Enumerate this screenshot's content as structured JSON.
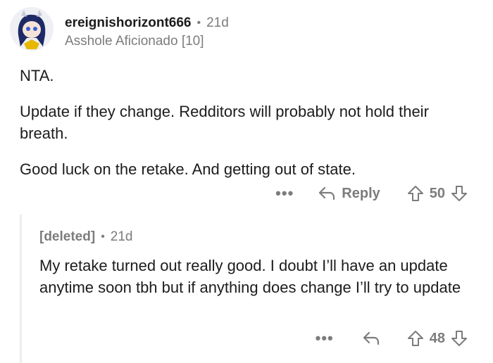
{
  "comment": {
    "username": "ereignishorizont666",
    "separator": "•",
    "age": "21d",
    "flair": "Asshole Aficionado [10]",
    "paragraphs": [
      "NTA.",
      "Update if they change. Redditors will probably not hold their breath.",
      "Good luck on the retake. And getting out of state."
    ],
    "actions": {
      "more_label": "•••",
      "reply_label": "Reply",
      "vote_count": "50"
    }
  },
  "reply": {
    "username": "[deleted]",
    "separator": "•",
    "age": "21d",
    "body": "My retake turned out really good. I doubt I’ll have an update anytime soon tbh but if anything does change I’ll try to update",
    "actions": {
      "more_label": "•••",
      "vote_count": "48"
    }
  },
  "colors": {
    "text": "#1c1c1c",
    "muted": "#7c7c7c",
    "thread_line": "#ededed",
    "avatar_hair": "#1e2a66",
    "avatar_accent": "#e6b800"
  },
  "icons": [
    "avatar",
    "reply-arrow-icon",
    "upvote-icon",
    "downvote-icon",
    "more-icon"
  ]
}
